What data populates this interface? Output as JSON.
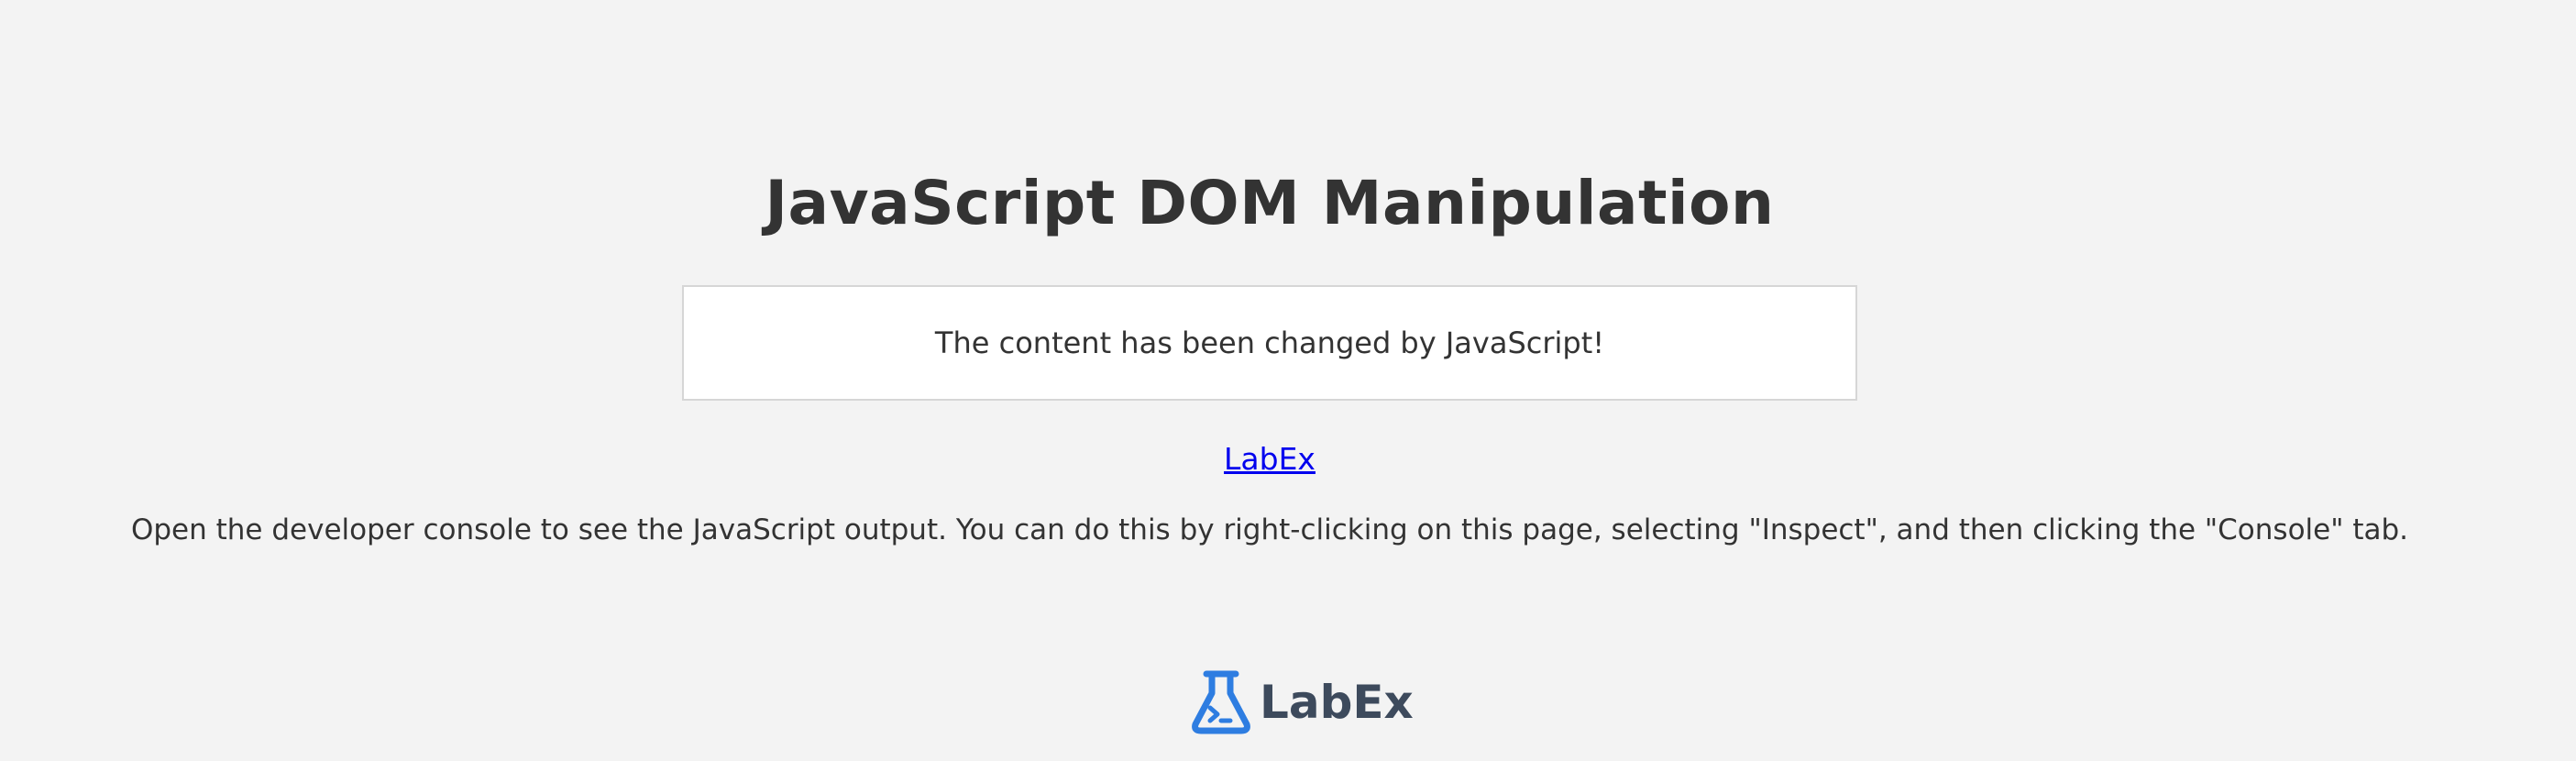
{
  "page": {
    "title": "JavaScript DOM Manipulation",
    "content_text": "The content has been changed by JavaScript!",
    "link_text": "LabEx",
    "instructions": "Open the developer console to see the JavaScript output. You can do this by right-clicking on this page, selecting \"Inspect\", and then clicking the \"Console\" tab."
  },
  "footer": {
    "logo_text": "LabEx",
    "logo_icon": "flask-icon"
  },
  "colors": {
    "background": "#f3f3f3",
    "text": "#333333",
    "link": "#0000ee",
    "logo_blue": "#2e7de1",
    "logo_text": "#3d4a5c"
  }
}
